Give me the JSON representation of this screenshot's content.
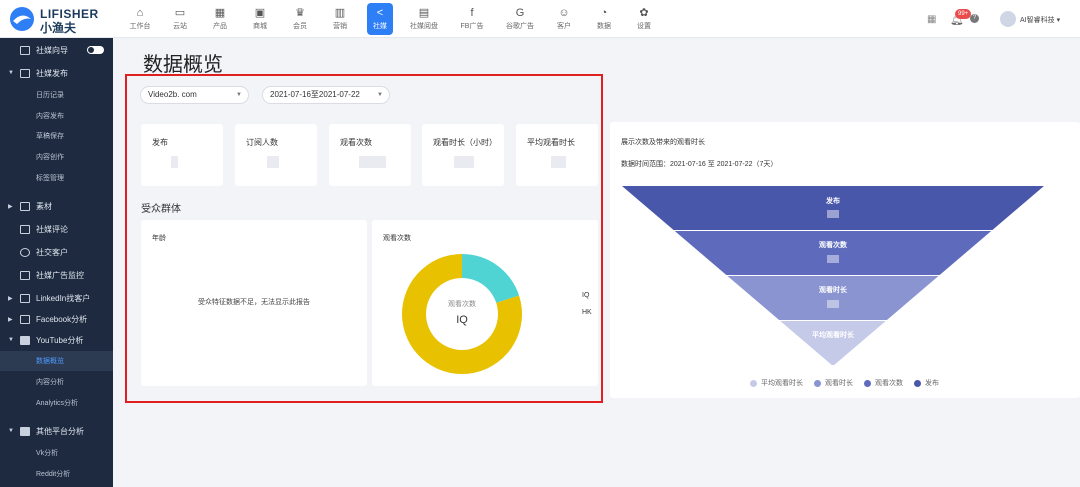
{
  "brand": {
    "name": "LIFISHER",
    "sub": "小渔夫"
  },
  "nav": [
    {
      "icon": "⌂",
      "label": "工作台"
    },
    {
      "icon": "▭",
      "label": "云站"
    },
    {
      "icon": "▦",
      "label": "产品"
    },
    {
      "icon": "▣",
      "label": "商城"
    },
    {
      "icon": "♛",
      "label": "会员"
    },
    {
      "icon": "▥",
      "label": "营销"
    },
    {
      "icon": "<",
      "label": "社媒"
    },
    {
      "icon": "▤",
      "label": "社媒阅盘"
    },
    {
      "icon": "f",
      "label": "FB广告"
    },
    {
      "icon": "G",
      "label": "谷歌广告"
    },
    {
      "icon": "☺",
      "label": "客户"
    },
    {
      "icon": "◔",
      "label": "数据"
    },
    {
      "icon": "✿",
      "label": "设置"
    }
  ],
  "topbar": {
    "badge": "99+",
    "help": "?",
    "user": "AI智睿科技"
  },
  "sidebar": {
    "items": [
      {
        "label": "社媒向导"
      },
      {
        "label": "社媒发布"
      },
      {
        "label": "日历记录"
      },
      {
        "label": "内容发布"
      },
      {
        "label": "草稿保存"
      },
      {
        "label": "内容创作"
      },
      {
        "label": "标签管理"
      },
      {
        "label": "素材"
      },
      {
        "label": "社媒评论"
      },
      {
        "label": "社交客户"
      },
      {
        "label": "社媒广告监控"
      },
      {
        "label": "LinkedIn找客户"
      },
      {
        "label": "Facebook分析"
      },
      {
        "label": "YouTube分析"
      },
      {
        "label": "数据概览"
      },
      {
        "label": "内容分析"
      },
      {
        "label": "Analytics分析"
      },
      {
        "label": "其他平台分析"
      },
      {
        "label": "Vk分析"
      },
      {
        "label": "Reddit分析"
      }
    ]
  },
  "page": {
    "title": "数据概览",
    "channel_select": "Video2b. com",
    "date_select": "2021-07-16至2021-07-22",
    "stats": [
      {
        "label": "发布"
      },
      {
        "label": "订阅人数"
      },
      {
        "label": "观看次数"
      },
      {
        "label": "观看时长（小时）"
      },
      {
        "label": "平均观看时长"
      }
    ],
    "audience_title": "受众群体",
    "age_card": {
      "label": "年龄",
      "message": "受众特征数据不足，无法显示此报告"
    },
    "views_card": {
      "label": "观看次数",
      "center_label": "观看次数",
      "center_value": "IQ",
      "legend": [
        "IQ",
        "HK"
      ],
      "share": [
        0.2,
        0.8
      ],
      "colors": [
        "#4fd3d3",
        "#e8c100"
      ]
    }
  },
  "funnel": {
    "title": "展示次数及带来的观看时长",
    "range": "数据时间范围：2021-07-16 至 2021-07-22（7天）",
    "stages": [
      {
        "label": "发布",
        "color": "#4957ab"
      },
      {
        "label": "观看次数",
        "color": "#5e6bbd"
      },
      {
        "label": "观看时长",
        "color": "#8a94d0"
      },
      {
        "label": "平均观看时长",
        "color": "#c5cae9"
      }
    ],
    "legend": [
      {
        "label": "平均观看时长",
        "color": "#c5cae9"
      },
      {
        "label": "观看时长",
        "color": "#8a94d0"
      },
      {
        "label": "观看次数",
        "color": "#5e6bbd"
      },
      {
        "label": "发布",
        "color": "#4957ab"
      }
    ]
  }
}
